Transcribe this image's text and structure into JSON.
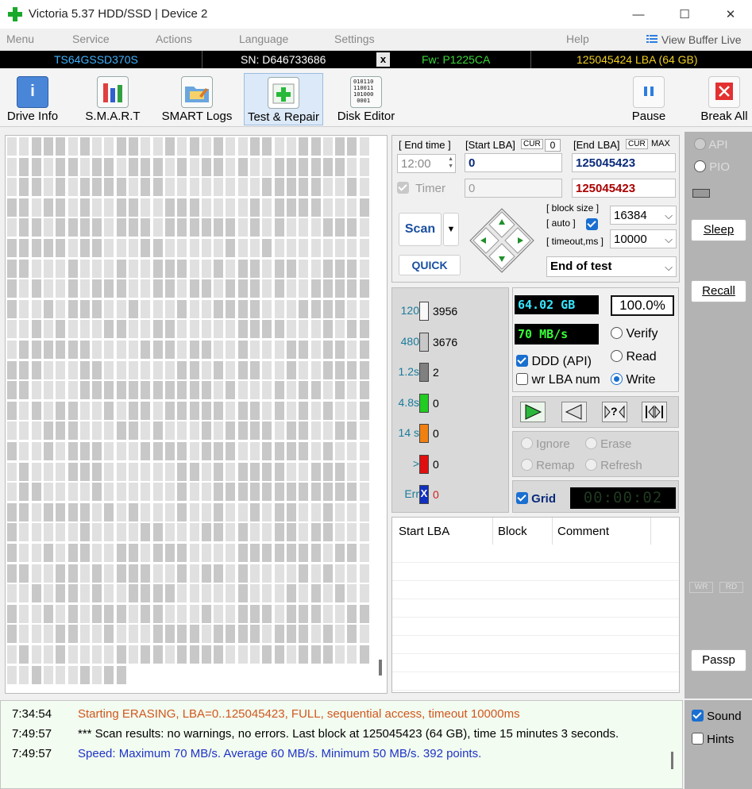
{
  "window": {
    "title": "Victoria 5.37 HDD/SSD | Device 2",
    "controls": {
      "minimize": "—",
      "maximize": "☐",
      "close": "✕"
    }
  },
  "menu": {
    "items": [
      "Menu",
      "Service",
      "Actions",
      "Language",
      "Settings",
      "Help"
    ],
    "view_buffer": "View Buffer Live"
  },
  "device": {
    "model": "TS64GSSD370S",
    "serial": "SN: D646733686",
    "close_mark": "x",
    "firmware": "Fw: P1225CA",
    "capacity": "125045424 LBA (64 GB)"
  },
  "toolbar": {
    "drive_info": "Drive Info",
    "smart": "S.M.A.R.T",
    "smart_logs": "SMART Logs",
    "test_repair": "Test & Repair",
    "disk_editor": "Disk Editor",
    "disk_editor_glyph": "010110\n110011\n101000\n0001",
    "pause": "Pause",
    "break_all": "Break All"
  },
  "params": {
    "end_time_label": "[ End time ]",
    "end_time_value": "12:00",
    "start_lba_label": "[Start LBA]",
    "cur_label": "CUR",
    "start_cur_value": "0",
    "start_lba_value": "0",
    "end_lba_label": "[End LBA]",
    "max_label": "MAX",
    "end_lba_value": "125045423",
    "end_lba_max_value": "125045423",
    "timer_label": "Timer",
    "timer_value": "0",
    "block_size_label": "[ block size ]",
    "auto_label": "[ auto ]",
    "block_size_value": "16384",
    "timeout_label": "[ timeout,ms ]",
    "timeout_value": "10000",
    "scan_label": "Scan",
    "quick_label": "QUICK",
    "end_action": "End of test"
  },
  "legend": [
    {
      "label": "120",
      "count": "3956",
      "color": "#f8f8f8"
    },
    {
      "label": "480",
      "count": "3676",
      "color": "#c8c8c8"
    },
    {
      "label": "1.2s",
      "count": "2",
      "color": "#808080"
    },
    {
      "label": "4.8s",
      "count": "0",
      "color": "#22cc22"
    },
    {
      "label": "14 s",
      "count": "0",
      "color": "#f08010"
    },
    {
      "label": ">",
      "count": "0",
      "color": "#e01010"
    },
    {
      "label": "Err",
      "count": "0",
      "color": "#1030c0"
    }
  ],
  "err_mark": "X",
  "stats": {
    "size": "64.02 GB",
    "percent": "100.0%",
    "speed": "70 MB/s",
    "ddd": "DDD (API)",
    "wr_lba": "wr LBA num",
    "verify": "Verify",
    "read": "Read",
    "write": "Write",
    "unknown": "?",
    "ignore": "Ignore",
    "erase": "Erase",
    "remap": "Remap",
    "refresh": "Refresh",
    "grid": "Grid",
    "elapsed": "00:00:02"
  },
  "table": {
    "columns": [
      "Start LBA",
      "Block",
      "Comment"
    ]
  },
  "side": {
    "api": "API",
    "pio": "PIO",
    "sleep": "Sleep",
    "recall": "Recall",
    "wr": "WR",
    "rd": "RD",
    "passp": "Passp",
    "sound": "Sound",
    "hints": "Hints"
  },
  "log": [
    {
      "time": "7:34:54",
      "text": "Starting ERASING, LBA=0..125045423, FULL, sequential access, timeout 10000ms",
      "color": "#d2561e"
    },
    {
      "time": "7:49:57",
      "text": "*** Scan results: no warnings, no errors. Last block at 125045423 (64 GB), time 15 minutes 3 seconds.",
      "color": "#000000"
    },
    {
      "time": "7:49:57",
      "text": "Speed: Maximum 70 MB/s. Average 60 MB/s. Minimum 50 MB/s. 392 points.",
      "color": "#1f33c8"
    }
  ],
  "colors": {
    "accent": "#1a6fd0",
    "device_model": "#3fb2ff",
    "device_fw": "#38d838",
    "device_capacity": "#f0d020",
    "lcd_green": "#38ff38",
    "lcd_cyan": "#38e6ff",
    "end_lba_max": "#aa0000",
    "log_orange": "#d2561e",
    "log_blue": "#1f33c8"
  }
}
